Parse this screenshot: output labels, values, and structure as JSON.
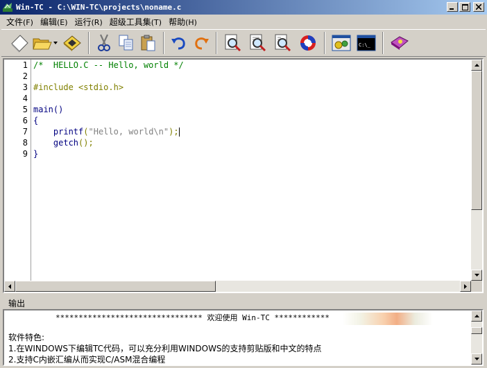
{
  "window": {
    "title": "Win-TC - C:\\WIN-TC\\projects\\noname.c"
  },
  "menu": [
    {
      "label": "文件",
      "key": "(F)"
    },
    {
      "label": "编辑",
      "key": "(E)"
    },
    {
      "label": "运行",
      "key": "(R)"
    },
    {
      "label": "超级工具集",
      "key": "(T)"
    },
    {
      "label": "帮助",
      "key": "(H)"
    }
  ],
  "toolbar": {
    "icons": [
      "new-file-icon",
      "open-folder-icon",
      "save-icon",
      "cut-icon",
      "copy-icon",
      "paste-icon",
      "undo-icon",
      "redo-icon",
      "find-icon",
      "find-next-icon",
      "replace-icon",
      "refresh-icon",
      "compile-run-icon",
      "console-icon",
      "help-book-icon"
    ],
    "console_label": "C:\\_"
  },
  "editor": {
    "line_numbers": [
      "1",
      "2",
      "3",
      "4",
      "5",
      "6",
      "7",
      "8",
      "9"
    ],
    "lines": {
      "l1": "/*  HELLO.C -- Hello, world */",
      "l3": "#include <stdio.h>",
      "l5": "main()",
      "l6": "{",
      "l7_indent": "    ",
      "l7_fn": "printf",
      "l7_open": "(",
      "l7_str": "\"Hello, world\\n\"",
      "l7_close": ");",
      "l8_indent": "    ",
      "l8_fn": "getch",
      "l8_punc": "();",
      "l9": "}"
    }
  },
  "output": {
    "label": "输出",
    "banner": "******************************** 欢迎使用 Win-TC ************",
    "lines": [
      "软件特色:",
      "1.在WINDOWS下编辑TC代码，可以充分利用WINDOWS的支持剪贴版和中文的特点",
      "2.支持C内嵌汇编从而实现C/ASM混合编程"
    ]
  }
}
